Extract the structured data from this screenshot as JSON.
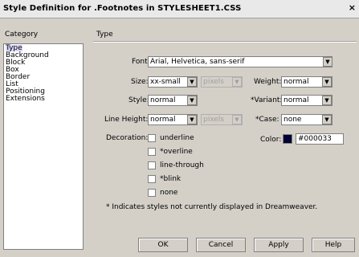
{
  "window": {
    "title": "Style Definition for .Footnotes in STYLESHEET1.CSS",
    "close_glyph": "×"
  },
  "category": {
    "header": "Category",
    "items": [
      "Type",
      "Background",
      "Block",
      "Box",
      "Border",
      "List",
      "Positioning",
      "Extensions"
    ],
    "selected": "Type"
  },
  "panel": {
    "header": "Type"
  },
  "form": {
    "font_label": "Font:",
    "font_value": "Arial, Helvetica, sans-serif",
    "size_label": "Size:",
    "size_value": "xx-small",
    "size_unit": "pixels",
    "weight_label": "Weight:",
    "weight_value": "normal",
    "style_label": "Style:",
    "style_value": "normal",
    "variant_label": "*Variant:",
    "variant_value": "normal",
    "lineheight_label": "Line Height:",
    "lineheight_value": "normal",
    "lineheight_unit": "pixels",
    "case_label": "*Case:",
    "case_value": "none",
    "decoration_label": "Decoration:",
    "decorations": [
      "underline",
      "*overline",
      "line-through",
      "*blink",
      "none"
    ],
    "color_label": "Color:",
    "color_value": "#000033"
  },
  "footnote": "* Indicates styles not currently displayed in Dreamweaver.",
  "buttons": {
    "ok": "OK",
    "cancel": "Cancel",
    "apply": "Apply",
    "help": "Help"
  },
  "colors": {
    "swatch": "#000033",
    "selection": "#d8d8ff"
  }
}
